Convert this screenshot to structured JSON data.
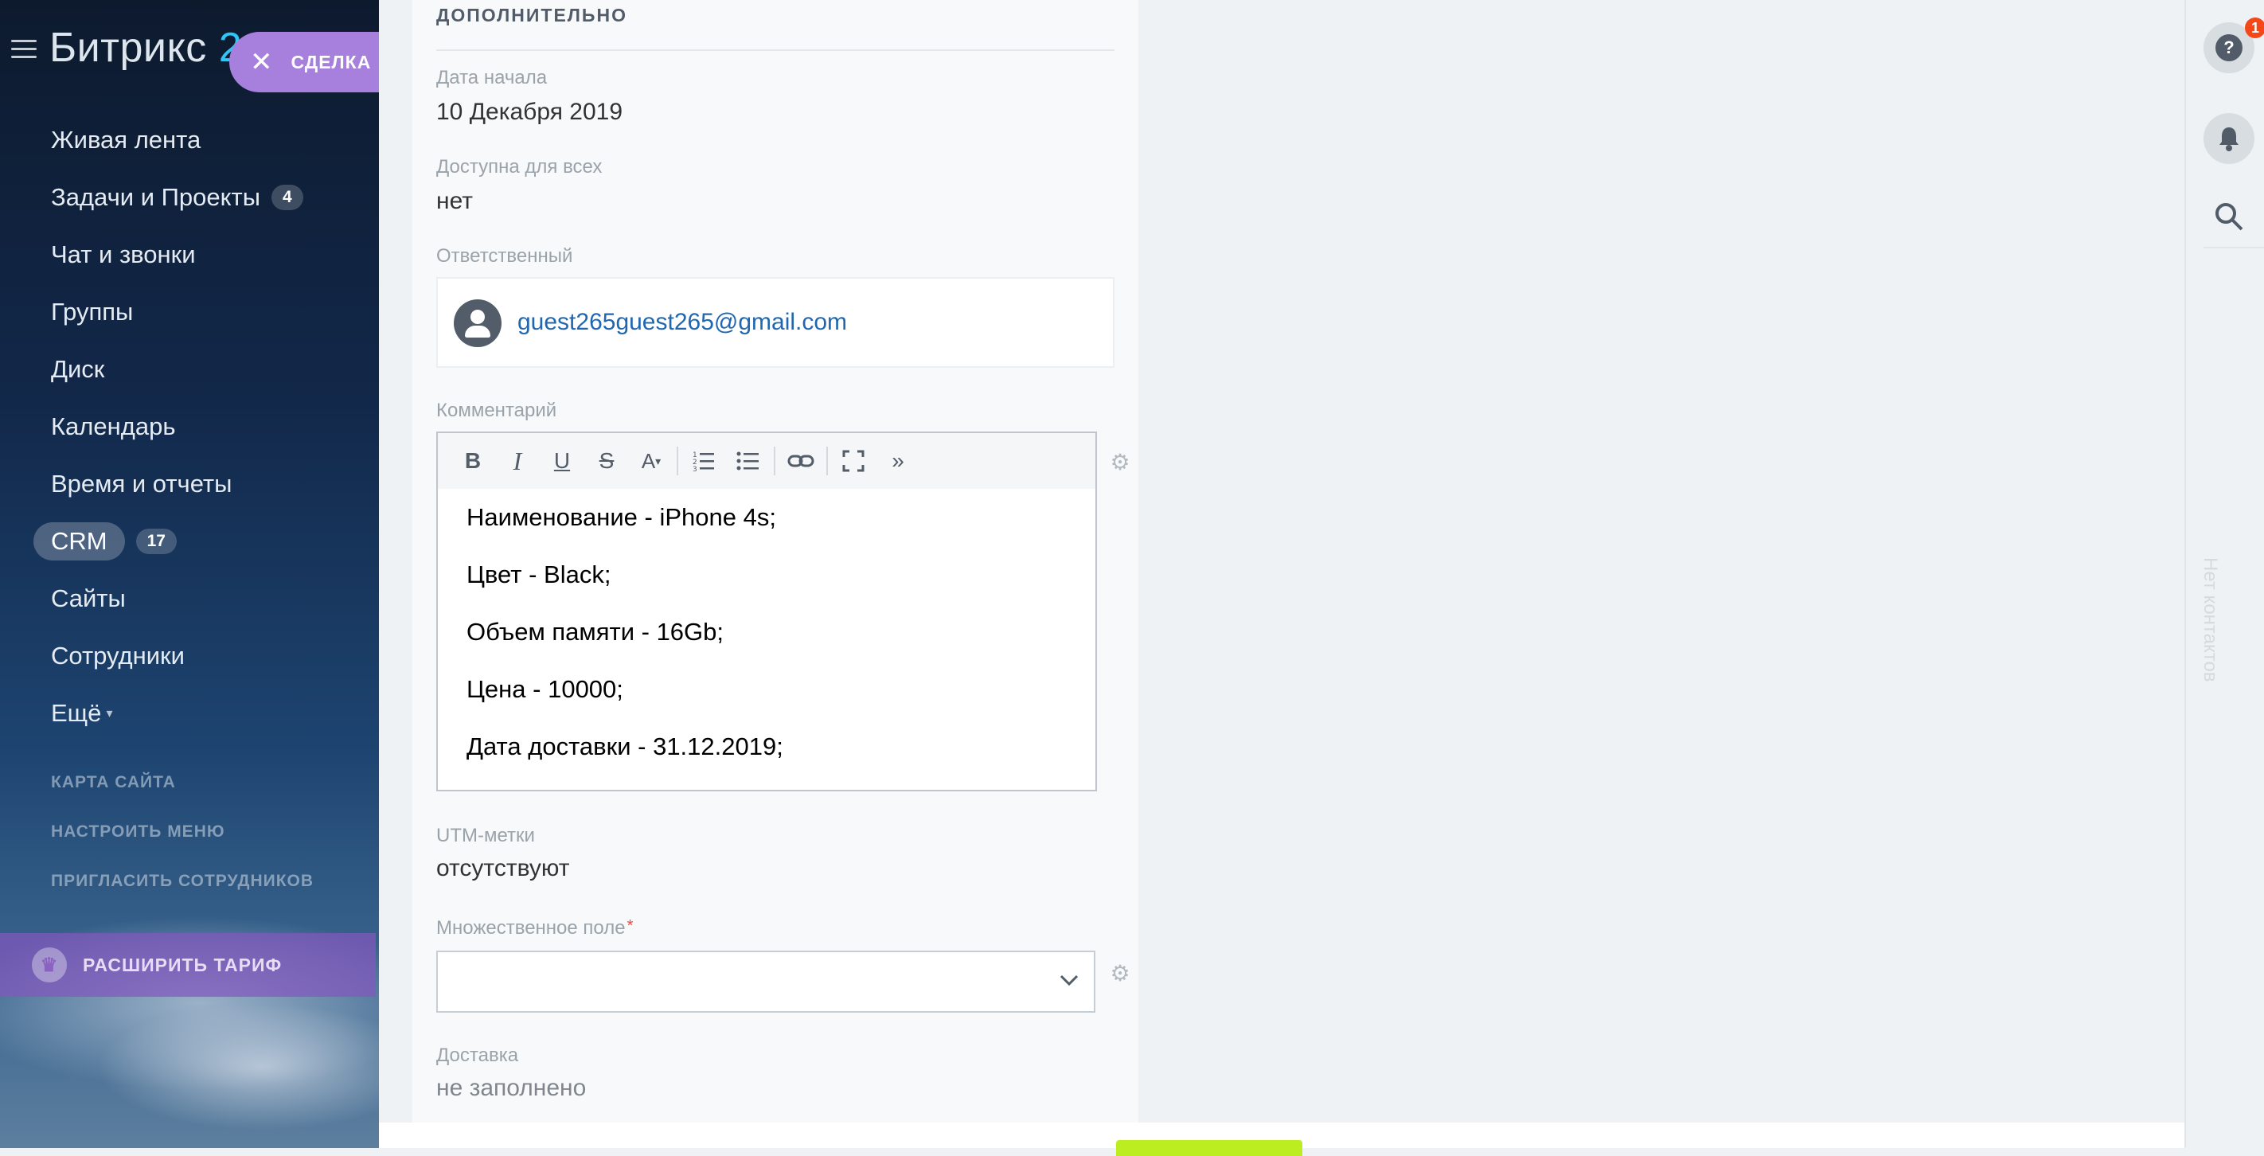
{
  "sidebar": {
    "logo_text": "Битрикс",
    "logo_number": "2",
    "items": [
      {
        "label": "Живая лента"
      },
      {
        "label": "Задачи и Проекты",
        "badge": "4"
      },
      {
        "label": "Чат и звонки"
      },
      {
        "label": "Группы"
      },
      {
        "label": "Диск"
      },
      {
        "label": "Календарь"
      },
      {
        "label": "Время и отчеты"
      },
      {
        "label": "CRM",
        "badge": "17"
      },
      {
        "label": "Сайты"
      },
      {
        "label": "Сотрудники"
      },
      {
        "label": "Ещё"
      }
    ],
    "links": [
      "КАРТА САЙТА",
      "НАСТРОИТЬ МЕНЮ",
      "ПРИГЛАСИТЬ СОТРУДНИКОВ"
    ],
    "upgrade_label": "РАСШИРИТЬ ТАРИФ"
  },
  "deal_tab": {
    "label": "СДЕЛКА"
  },
  "card": {
    "section_title": "ДОПОЛНИТЕЛЬНО",
    "start_date": {
      "label": "Дата начала",
      "value": "10 Декабря 2019"
    },
    "available": {
      "label": "Доступна для всех",
      "value": "нет"
    },
    "responsible": {
      "label": "Ответственный",
      "value": "guest265guest265@gmail.com"
    },
    "comment": {
      "label": "Комментарий",
      "lines": [
        "Наименование - iPhone 4s;",
        "Цвет - Black;",
        "Объем памяти - 16Gb;",
        "Цена - 10000;",
        "Дата доставки - 31.12.2019;"
      ]
    },
    "utm": {
      "label": "UTM-метки",
      "value": "отсутствуют"
    },
    "multi_field": {
      "label": "Множественное поле",
      "required_mark": "*",
      "value": ""
    },
    "delivery": {
      "label": "Доставка",
      "value": "не заполнено"
    }
  },
  "rightbar": {
    "help_badge": "1",
    "help_symbol": "?",
    "no_contacts": "Нет контактов"
  },
  "colors": {
    "accent_purple": "#a780dd",
    "link_blue": "#2067b0",
    "save_green": "#bbed21",
    "notification_red": "#f54819"
  }
}
